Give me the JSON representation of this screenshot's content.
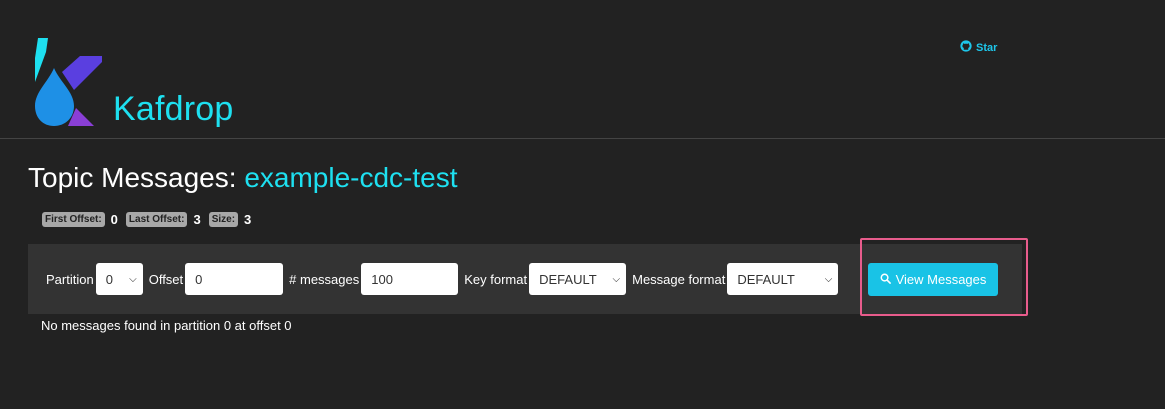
{
  "header": {
    "brand": "Kafdrop",
    "star_label": "Star"
  },
  "page": {
    "title_prefix": "Topic Messages: ",
    "topic_name": "example-cdc-test"
  },
  "stats": {
    "first_offset_label": "First Offset:",
    "first_offset_value": "0",
    "last_offset_label": "Last Offset:",
    "last_offset_value": "3",
    "size_label": "Size:",
    "size_value": "3"
  },
  "form": {
    "partition_label": "Partition",
    "partition_value": "0",
    "offset_label": "Offset",
    "offset_value": "0",
    "messages_label": "# messages",
    "messages_value": "100",
    "key_format_label": "Key format",
    "key_format_value": "DEFAULT",
    "message_format_label": "Message format",
    "message_format_value": "DEFAULT",
    "view_button_label": "View Messages"
  },
  "status": {
    "empty_message": "No messages found in partition 0 at offset 0"
  },
  "colors": {
    "accent": "#1ee0f0",
    "button": "#19c3e6",
    "highlight": "#e85c8c",
    "background": "#222222",
    "panel": "#333333"
  },
  "icons": {
    "logo": "kafdrop-logo",
    "star": "github-icon",
    "view_button": "search-icon",
    "select_arrow": "chevron-down-icon"
  }
}
